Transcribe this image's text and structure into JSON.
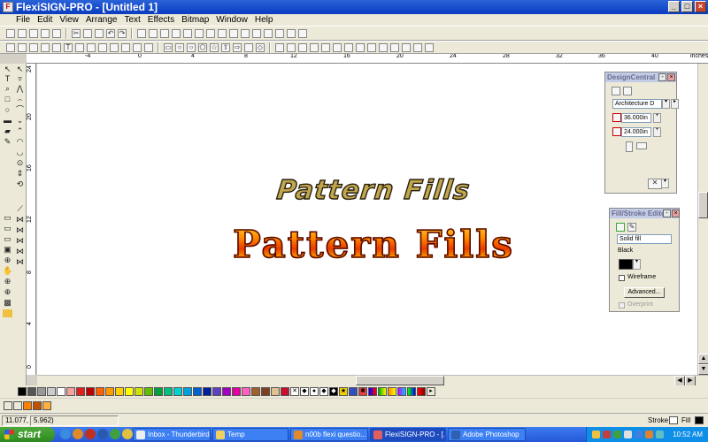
{
  "window": {
    "title": "FlexiSIGN-PRO - [Untitled 1]",
    "app_icon": "flexi-app-icon"
  },
  "menu": [
    "File",
    "Edit",
    "View",
    "Arrange",
    "Text",
    "Effects",
    "Bitmap",
    "Window",
    "Help"
  ],
  "ruler": {
    "unit": "inches",
    "h_numbers": [
      "-4",
      "0",
      "4",
      "8",
      "12",
      "16",
      "20",
      "24",
      "28",
      "32",
      "36",
      "40"
    ],
    "v_numbers": [
      "24",
      "20",
      "16",
      "12",
      "8",
      "4",
      "0"
    ]
  },
  "canvas": {
    "text1": "Pattern Fills",
    "text2": "Pattern Fills"
  },
  "design_central": {
    "title": "DesignCentral",
    "preset": "Architecture D",
    "width": "36.000in",
    "height": "24.000in"
  },
  "fill_stroke": {
    "title": "Fill/Stroke Edito",
    "fill_type": "Solid fill",
    "color_name": "Black",
    "wireframe_label": "Wireframe",
    "advanced_label": "Advanced...",
    "overprint_label": "Overprint"
  },
  "status": {
    "x": "11.077,",
    "y": "5.962)",
    "stroke_label": "Stroke",
    "fill_label": "Fill"
  },
  "taskbar": {
    "start_label": "start",
    "tasks": [
      "Inbox - Thunderbird",
      "Temp",
      "n00b flexi questio...",
      "FlexiSIGN-PRO - [...",
      "Adobe Photoshop"
    ],
    "clock": "10:52 AM"
  },
  "colors": {
    "accent": "#0a3cc0",
    "taskbar": "#2458d8",
    "start": "#2e8a20"
  }
}
